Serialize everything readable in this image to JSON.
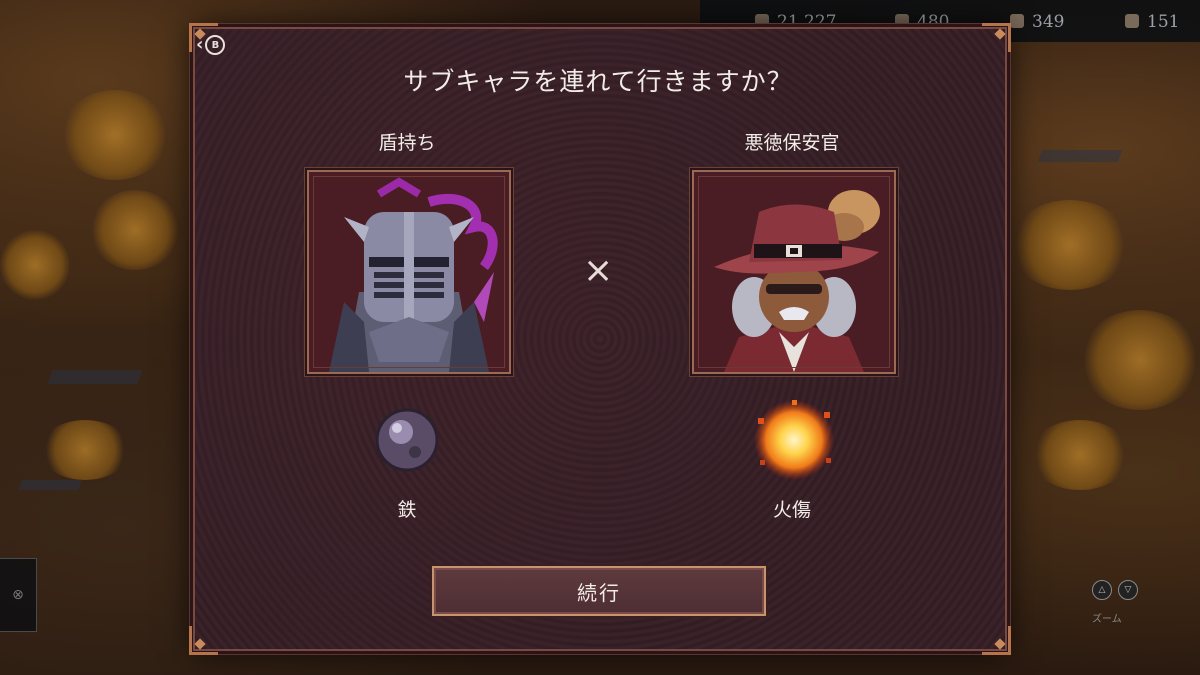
{
  "resources": [
    {
      "icon": "coin-icon",
      "value": "21,227"
    },
    {
      "icon": "wheat-icon",
      "value": "480"
    },
    {
      "icon": "gem-icon",
      "value": "349"
    },
    {
      "icon": "meat-icon",
      "value": "151"
    }
  ],
  "dialog": {
    "back_button_glyph": "B",
    "title": "サブキャラを連れて行きますか？",
    "separator": "×",
    "left_character": {
      "name": "盾持ち",
      "ability": "鉄",
      "ability_icon": "iron-orb-icon"
    },
    "right_character": {
      "name": "悪徳保安官",
      "ability": "火傷",
      "ability_icon": "fire-burst-icon"
    },
    "continue_label": "続行"
  },
  "hud": {
    "zoom_label": "ズーム"
  }
}
